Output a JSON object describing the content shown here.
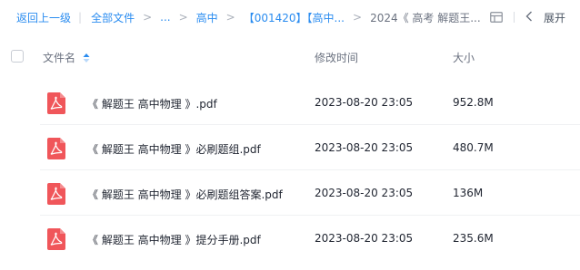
{
  "breadcrumb": {
    "back_label": "返回上一级",
    "all_files_label": "全部文件",
    "ellipsis": "...",
    "level_high_school": "高中",
    "level_folder": "【001420】【高中...",
    "current": "2024《 高考 解题王..."
  },
  "toolbar": {
    "expand_label": "展开",
    "layout_icon": "table-layout-icon",
    "collapse_icon": "chevron-left-icon"
  },
  "table": {
    "headers": {
      "name": "文件名",
      "modified": "修改时间",
      "size": "大小"
    },
    "rows": [
      {
        "icon": "pdf-file-icon",
        "name": "《 解题王 高中物理 》.pdf",
        "modified": "2023-08-20 23:05",
        "size": "952.8M"
      },
      {
        "icon": "pdf-file-icon",
        "name": "《 解题王 高中物理 》必刷题组.pdf",
        "modified": "2023-08-20 23:05",
        "size": "480.7M"
      },
      {
        "icon": "pdf-file-icon",
        "name": "《 解题王 高中物理 》必刷题组答案.pdf",
        "modified": "2023-08-20 23:05",
        "size": "136M"
      },
      {
        "icon": "pdf-file-icon",
        "name": "《 解题王 高中物理 》提分手册.pdf",
        "modified": "2023-08-20 23:05",
        "size": "235.6M"
      }
    ]
  },
  "colors": {
    "link": "#2a8cf0",
    "pdf_red": "#f0565a",
    "sort_active": "#2a8cf0"
  }
}
